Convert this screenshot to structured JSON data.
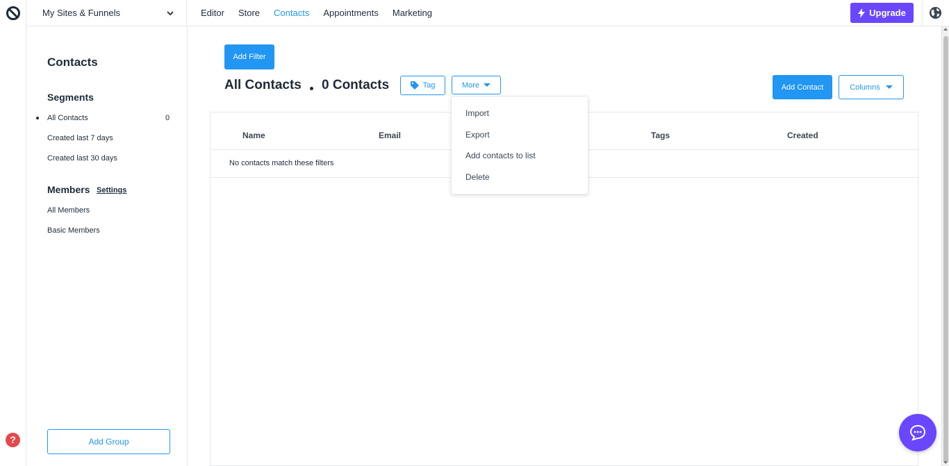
{
  "topbar": {
    "site_select_label": "My Sites & Funnels",
    "nav": [
      "Editor",
      "Store",
      "Contacts",
      "Appointments",
      "Marketing"
    ],
    "active_nav": "Contacts",
    "upgrade_label": "Upgrade"
  },
  "sidebar": {
    "title": "Contacts",
    "segments_heading": "Segments",
    "segments": [
      {
        "label": "All Contacts",
        "count": "0"
      },
      {
        "label": "Created last 7 days"
      },
      {
        "label": "Created last 30 days"
      }
    ],
    "members_heading": "Members",
    "settings_link": "Settings",
    "members": [
      "All Members",
      "Basic Members"
    ],
    "add_group_label": "Add Group"
  },
  "main": {
    "add_filter_label": "Add Filter",
    "heading": "All Contacts",
    "count_heading": "0 Contacts",
    "tag_label": "Tag",
    "more_label": "More",
    "add_contact_label": "Add Contact",
    "columns_label": "Columns",
    "table": {
      "headers": [
        "Name",
        "Email",
        "Tags",
        "Created"
      ],
      "empty_message": "No contacts match these filters"
    },
    "more_menu": [
      "Import",
      "Export",
      "Add contacts to list",
      "Delete"
    ]
  },
  "icons": {
    "logo": "brand-logo-icon",
    "chevron": "chevron-down-icon",
    "upgrade": "lightning-icon",
    "globe": "globe-icon",
    "tag": "tag-icon",
    "help": "help-icon",
    "chat": "chat-icon"
  },
  "colors": {
    "accent": "#2196f3",
    "upgrade": "#6b46ff",
    "help": "#e5484d"
  }
}
